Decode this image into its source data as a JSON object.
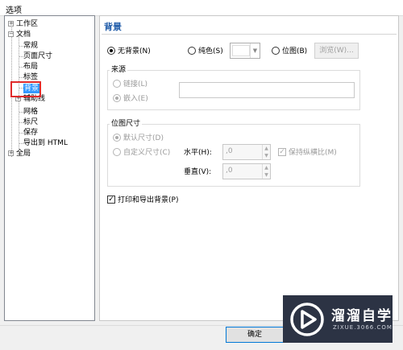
{
  "window": {
    "title": "选项"
  },
  "tree": {
    "items": [
      {
        "label": "工作区",
        "expander": "+"
      },
      {
        "label": "文档",
        "expander": "−"
      },
      {
        "label": "常规"
      },
      {
        "label": "页面尺寸"
      },
      {
        "label": "布局"
      },
      {
        "label": "标签"
      },
      {
        "label": "背景"
      },
      {
        "label": "辅助线",
        "expander": "+"
      },
      {
        "label": "网格"
      },
      {
        "label": "标尺"
      },
      {
        "label": "保存"
      },
      {
        "label": "导出到 HTML"
      },
      {
        "label": "全局",
        "expander": "+"
      }
    ]
  },
  "panel": {
    "title": "背景",
    "bg_options": {
      "none": "无背景(N)",
      "solid": "纯色(S)",
      "bitmap": "位图(B)",
      "browse": "浏览(W)..."
    },
    "source": {
      "title": "来源",
      "link": "链接(L)",
      "embed": "嵌入(E)"
    },
    "bitmap_size": {
      "title": "位图尺寸",
      "default": "默认尺寸(D)",
      "custom": "自定义尺寸(C)",
      "horizontal_label": "水平(H):",
      "horizontal_value": ",0",
      "vertical_label": "垂直(V):",
      "vertical_value": ",0",
      "keep_ratio": "保持纵横比(M)"
    },
    "print_export": "打印和导出背景(P)"
  },
  "footer": {
    "ok": "确定"
  },
  "watermark": {
    "text": "溜溜自学",
    "url": "ZIXUE.3066.COM"
  },
  "colors": {
    "title_blue": "#1e5aa8",
    "selection": "#3399ff",
    "highlight_box": "#e02b2b"
  }
}
